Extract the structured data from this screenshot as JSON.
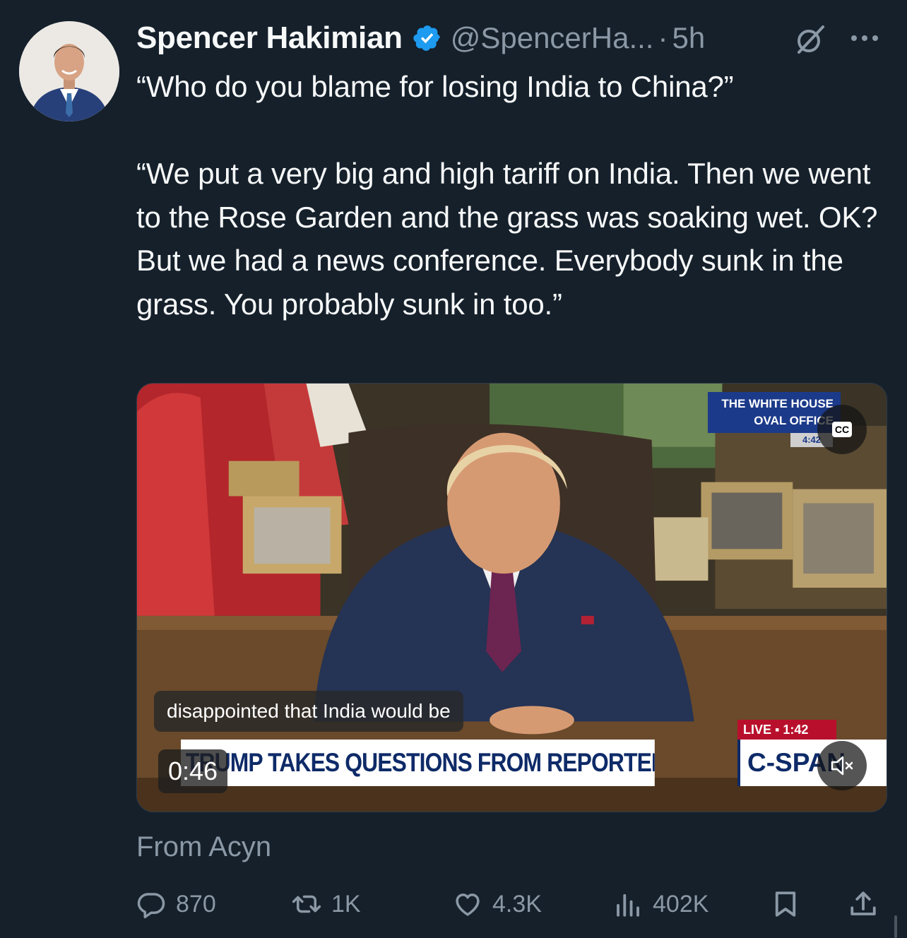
{
  "author": {
    "display_name": "Spencer Hakimian",
    "handle": "@SpencerHa...",
    "separator": "·",
    "time": "5h",
    "verified_color": "#1d9bf0"
  },
  "icons": {
    "verified": "verified-badge-icon",
    "grok": "grok-icon",
    "more": "more-options-icon",
    "reply": "reply-icon",
    "retweet": "retweet-icon",
    "like": "like-icon",
    "views": "views-icon",
    "bookmark": "bookmark-icon",
    "share": "share-icon",
    "mute": "mute-icon"
  },
  "tweet": {
    "text": "“Who do you blame for losing India to China?”\n\n“We put a very big and high tariff on India. Then we went to the Rose Garden and the grass was soaking wet. OK? But we had a news conference. Everybody sunk in the grass. You probably sunk in too.”"
  },
  "video": {
    "caption": "disappointed that India would be",
    "chyron": "TRUMP TAKES QUESTIONS FROM REPORTERS",
    "network": "C-SPAN",
    "live_label": "LIVE ▪ 1:42",
    "location_line1": "THE WHITE HOUSE",
    "location_line2": "OVAL OFFICE",
    "location_time": "4:42",
    "timer": "0:46",
    "cc_label": "CC"
  },
  "source": "From Acyn",
  "stats": {
    "replies": "870",
    "retweets": "1K",
    "likes": "4.3K",
    "views": "402K"
  },
  "colors": {
    "background": "#15202b",
    "text": "#f7f9f9",
    "secondary": "#8b98a5"
  }
}
